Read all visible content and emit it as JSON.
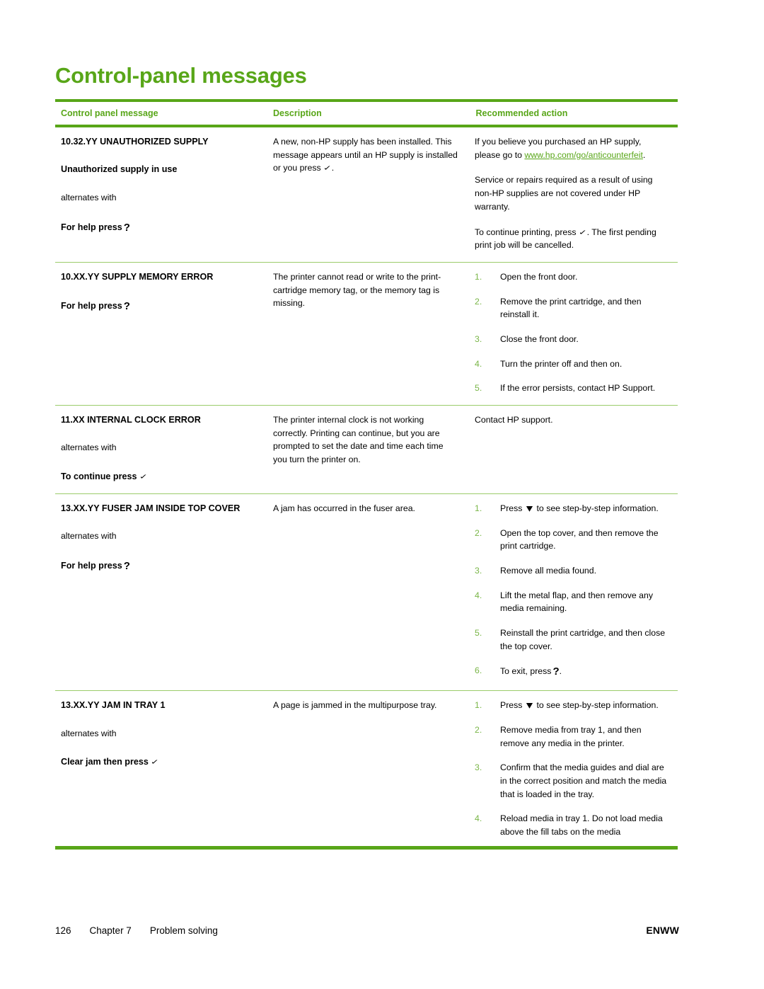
{
  "document": {
    "title": "Control-panel messages",
    "accent_color": "#58a618",
    "rule_color_light": "#9bcc6a",
    "list_marker_color": "#7ab648"
  },
  "table": {
    "headers": [
      "Control panel message",
      "Description",
      "Recommended action"
    ],
    "rows": [
      {
        "message": {
          "code": "10.32.YY UNAUTHORIZED SUPPLY",
          "sub_bold": "Unauthorized supply in use",
          "alternates_label": "alternates with",
          "press_prefix": "For help press",
          "press_glyph": "?"
        },
        "description": {
          "text_before_glyph": "A new, non-HP supply has been installed. This message appears until an HP supply is installed or you press",
          "glyph": "✓",
          "text_after_glyph": "."
        },
        "action": {
          "paragraphs": [
            {
              "before_link": "If you believe you purchased an HP supply, please go to ",
              "link": "www.hp.com/go/anticounterfeit",
              "after_link": "."
            },
            {
              "text": "Service or repairs required as a result of using non-HP supplies are not covered under HP warranty."
            },
            {
              "before_glyph": "To continue printing, press",
              "glyph": "✓",
              "after_glyph": ". The first pending print job will be cancelled."
            }
          ]
        }
      },
      {
        "message": {
          "code": "10.XX.YY SUPPLY MEMORY ERROR",
          "press_prefix": "For help press",
          "press_glyph": "?"
        },
        "description": {
          "text_before_glyph": "The printer cannot read or write to the print-cartridge memory tag, or the memory tag is missing."
        },
        "action": {
          "steps": [
            {
              "num": "1.",
              "text": "Open the front door."
            },
            {
              "num": "2.",
              "text": "Remove the print cartridge, and then reinstall it."
            },
            {
              "num": "3.",
              "text": "Close the front door."
            },
            {
              "num": "4.",
              "text": "Turn the printer off and then on."
            },
            {
              "num": "5.",
              "text": "If the error persists, contact HP Support."
            }
          ]
        }
      },
      {
        "message": {
          "code": "11.XX INTERNAL CLOCK ERROR",
          "alternates_label": "alternates with",
          "press_prefix": "To continue press",
          "press_glyph": "✓"
        },
        "description": {
          "text_before_glyph": "The printer internal clock is not working correctly. Printing can continue, but you are prompted to set the date and time each time you turn the printer on."
        },
        "action": {
          "paragraphs": [
            {
              "text": "Contact HP support."
            }
          ]
        }
      },
      {
        "message": {
          "code": "13.XX.YY FUSER JAM INSIDE TOP COVER",
          "alternates_label": "alternates with",
          "press_prefix": "For help press",
          "press_glyph": "?"
        },
        "description": {
          "text_before_glyph": "A jam has occurred in the fuser area."
        },
        "action": {
          "steps": [
            {
              "num": "1.",
              "before_glyph": "Press",
              "glyph": "▼",
              "after_glyph": "to see step-by-step information."
            },
            {
              "num": "2.",
              "text": "Open the top cover, and then remove the print cartridge."
            },
            {
              "num": "3.",
              "text": "Remove all media found."
            },
            {
              "num": "4.",
              "text": "Lift the metal flap, and then remove any media remaining."
            },
            {
              "num": "5.",
              "text": "Reinstall the print cartridge, and then close the top cover."
            },
            {
              "num": "6.",
              "before_glyph": "To exit, press",
              "glyph": "?",
              "after_glyph": "."
            }
          ]
        }
      },
      {
        "message": {
          "code": "13.XX.YY JAM IN TRAY 1",
          "alternates_label": "alternates with",
          "press_prefix": "Clear jam then press",
          "press_glyph": "✓"
        },
        "description": {
          "text_before_glyph": "A page is jammed in the multipurpose tray."
        },
        "action": {
          "steps": [
            {
              "num": "1.",
              "before_glyph": "Press",
              "glyph": "▼",
              "after_glyph": "to see step-by-step information."
            },
            {
              "num": "2.",
              "text": "Remove media from tray 1, and then remove any media in the printer."
            },
            {
              "num": "3.",
              "text": "Confirm that the media guides and dial are in the correct position and match the media that is loaded in the tray."
            },
            {
              "num": "4.",
              "text": "Reload media in tray 1. Do not load media above the fill tabs on the media"
            }
          ]
        }
      }
    ]
  },
  "footer": {
    "page_number": "126",
    "chapter": "Chapter 7",
    "section": "Problem solving",
    "locale": "ENWW"
  }
}
